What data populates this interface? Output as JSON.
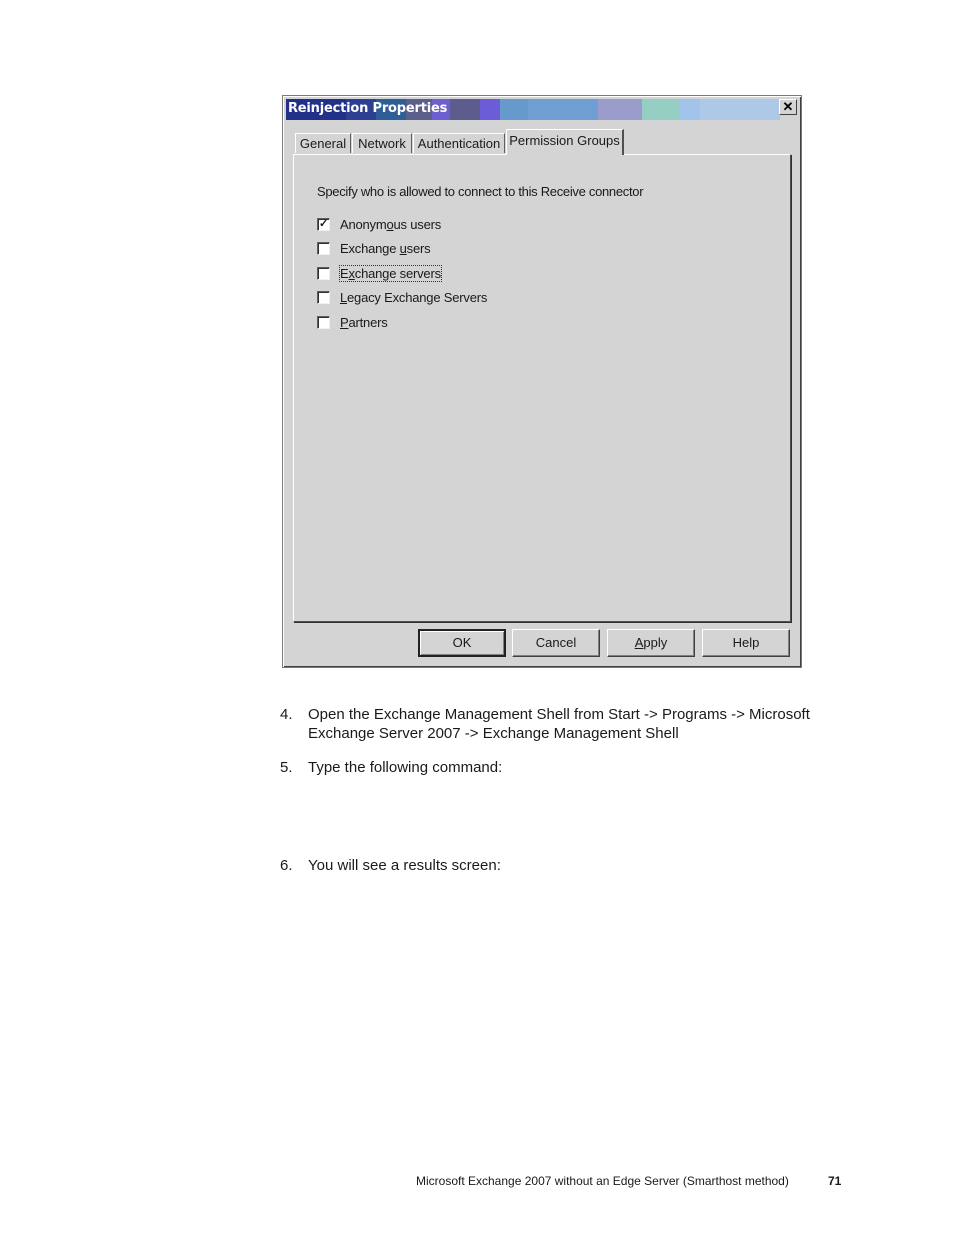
{
  "dialog": {
    "title": "Reinjection Properties",
    "close_icon": "close-icon",
    "title_colors": [
      "#22308a",
      "#2c3f90",
      "#2f5e96",
      "#5a5f8c",
      "#6e5fd0",
      "#5c5c8e",
      "#6c5cd8",
      "#6699cc",
      "#6f9ed2",
      "#9a9ccb",
      "#95cfc3",
      "#a2c4ea",
      "#aec9e8"
    ],
    "tabs": [
      {
        "label": "General",
        "active": false
      },
      {
        "label": "Network",
        "active": false
      },
      {
        "label": "Authentication",
        "active": false
      },
      {
        "label": "Permission Groups",
        "active": true
      }
    ],
    "description": "Specify who is allowed to connect to this Receive connector",
    "options": [
      {
        "label_pre": "Anonym",
        "accel": "o",
        "label_post": "us users",
        "checked": true,
        "focused": false
      },
      {
        "label_pre": "Exchange ",
        "accel": "u",
        "label_post": "sers",
        "checked": false,
        "focused": false
      },
      {
        "label_pre": "E",
        "accel": "x",
        "label_post": "change servers",
        "checked": false,
        "focused": true
      },
      {
        "label_pre": "",
        "accel": "L",
        "label_post": "egacy Exchange Servers",
        "checked": false,
        "focused": false
      },
      {
        "label_pre": "",
        "accel": "P",
        "label_post": "artners",
        "checked": false,
        "focused": false
      }
    ],
    "buttons": {
      "ok": "OK",
      "cancel": "Cancel",
      "apply_accel": "A",
      "apply_rest": "pply",
      "help": "Help"
    }
  },
  "steps": [
    {
      "num": "4.",
      "lines": [
        "Open the Exchange Management Shell from Start -> Programs -> Microsoft",
        "Exchange Server 2007 -> Exchange Management Shell"
      ]
    },
    {
      "num": "5.",
      "lines": [
        "Type the following command:"
      ]
    },
    {
      "num": "6.",
      "lines": [
        "You will see a results screen:"
      ]
    }
  ],
  "footer": {
    "title": "Microsoft Exchange 2007 without an Edge Server (Smarthost method)",
    "page": "71"
  }
}
